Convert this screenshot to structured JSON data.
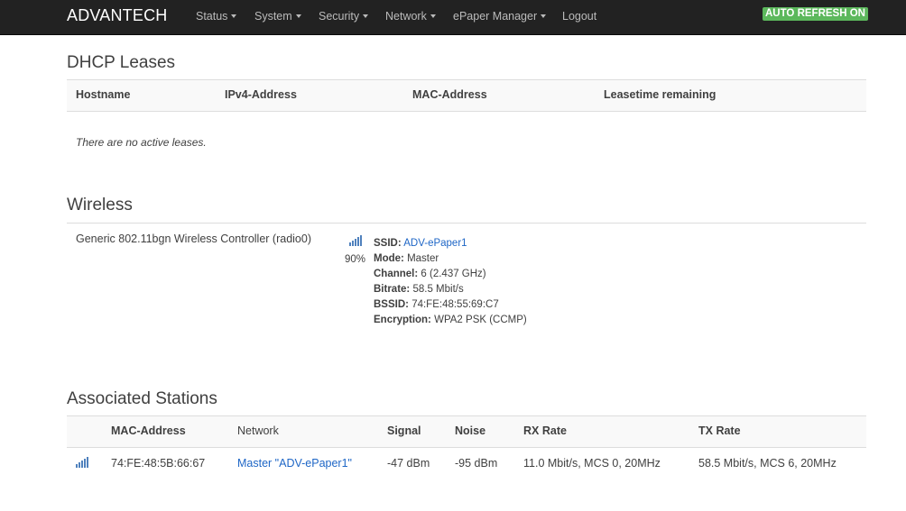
{
  "navbar": {
    "brand": "ADVANTECH",
    "menu": [
      {
        "label": "Status",
        "dropdown": true
      },
      {
        "label": "System",
        "dropdown": true
      },
      {
        "label": "Security",
        "dropdown": true
      },
      {
        "label": "Network",
        "dropdown": true
      },
      {
        "label": "ePaper Manager",
        "dropdown": true
      },
      {
        "label": "Logout",
        "dropdown": false
      }
    ],
    "auto_refresh": "AUTO REFRESH ON"
  },
  "dhcp": {
    "title": "DHCP Leases",
    "columns": [
      "Hostname",
      "IPv4-Address",
      "MAC-Address",
      "Leasetime remaining"
    ],
    "empty_message": "There are no active leases."
  },
  "wireless": {
    "title": "Wireless",
    "device": "Generic 802.11bgn Wireless Controller (radio0)",
    "signal_percent": "90%",
    "details": [
      {
        "key": "SSID:",
        "value": "ADV-ePaper1",
        "link": true
      },
      {
        "key": "Mode:",
        "value": "Master"
      },
      {
        "key": "Channel:",
        "value": "6 (2.437 GHz)"
      },
      {
        "key": "Bitrate:",
        "value": "58.5 Mbit/s"
      },
      {
        "key": "BSSID:",
        "value": "74:FE:48:55:69:C7"
      },
      {
        "key": "Encryption:",
        "value": "WPA2 PSK (CCMP)"
      }
    ]
  },
  "stations": {
    "title": "Associated Stations",
    "columns": [
      "MAC-Address",
      "Network",
      "Signal",
      "Noise",
      "RX Rate",
      "TX Rate"
    ],
    "rows": [
      {
        "mac": "74:FE:48:5B:66:67",
        "network": "Master \"ADV-ePaper1\"",
        "signal": "-47 dBm",
        "noise": "-95 dBm",
        "rx_rate": "11.0 Mbit/s, MCS 0, 20MHz",
        "tx_rate": "58.5 Mbit/s, MCS 6, 20MHz"
      }
    ]
  },
  "colors": {
    "navbar_bg": "#222222",
    "auto_refresh_bg": "#5cb85c",
    "link": "#1e66c6",
    "signal_icon": "#4f81bd"
  },
  "icons": {
    "signal": "signal-strength-icon",
    "caret": "chevron-down-icon"
  }
}
